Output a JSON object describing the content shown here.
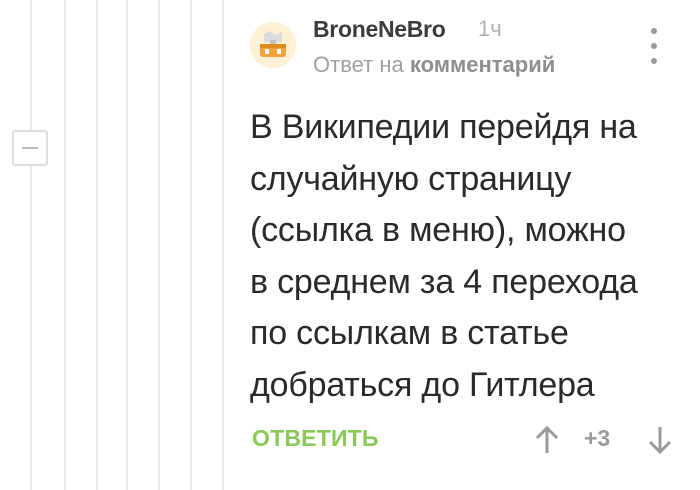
{
  "comment": {
    "author": "BroneNeBro",
    "time_ago": "1ч",
    "reply_prefix": "Ответ на",
    "reply_link": "комментарий",
    "text": "В Википедии перейдя на\nслучайную страницу\n(ссылка в меню), можно\nв среднем за 4 перехода\nпо ссылкам в статье\nдобраться до Гитлера",
    "reply_label": "ОТВЕТИТЬ",
    "rating": "+3"
  },
  "icons": {
    "avatar": "avatar-image",
    "collapse": "minus-icon",
    "more": "vertical-dots-icon",
    "upvote": "arrow-up-icon",
    "downvote": "arrow-down-icon"
  },
  "colors": {
    "reply_green": "#8ac858",
    "thread_line": "#e6e6e6",
    "text": "#2a2a2a"
  }
}
